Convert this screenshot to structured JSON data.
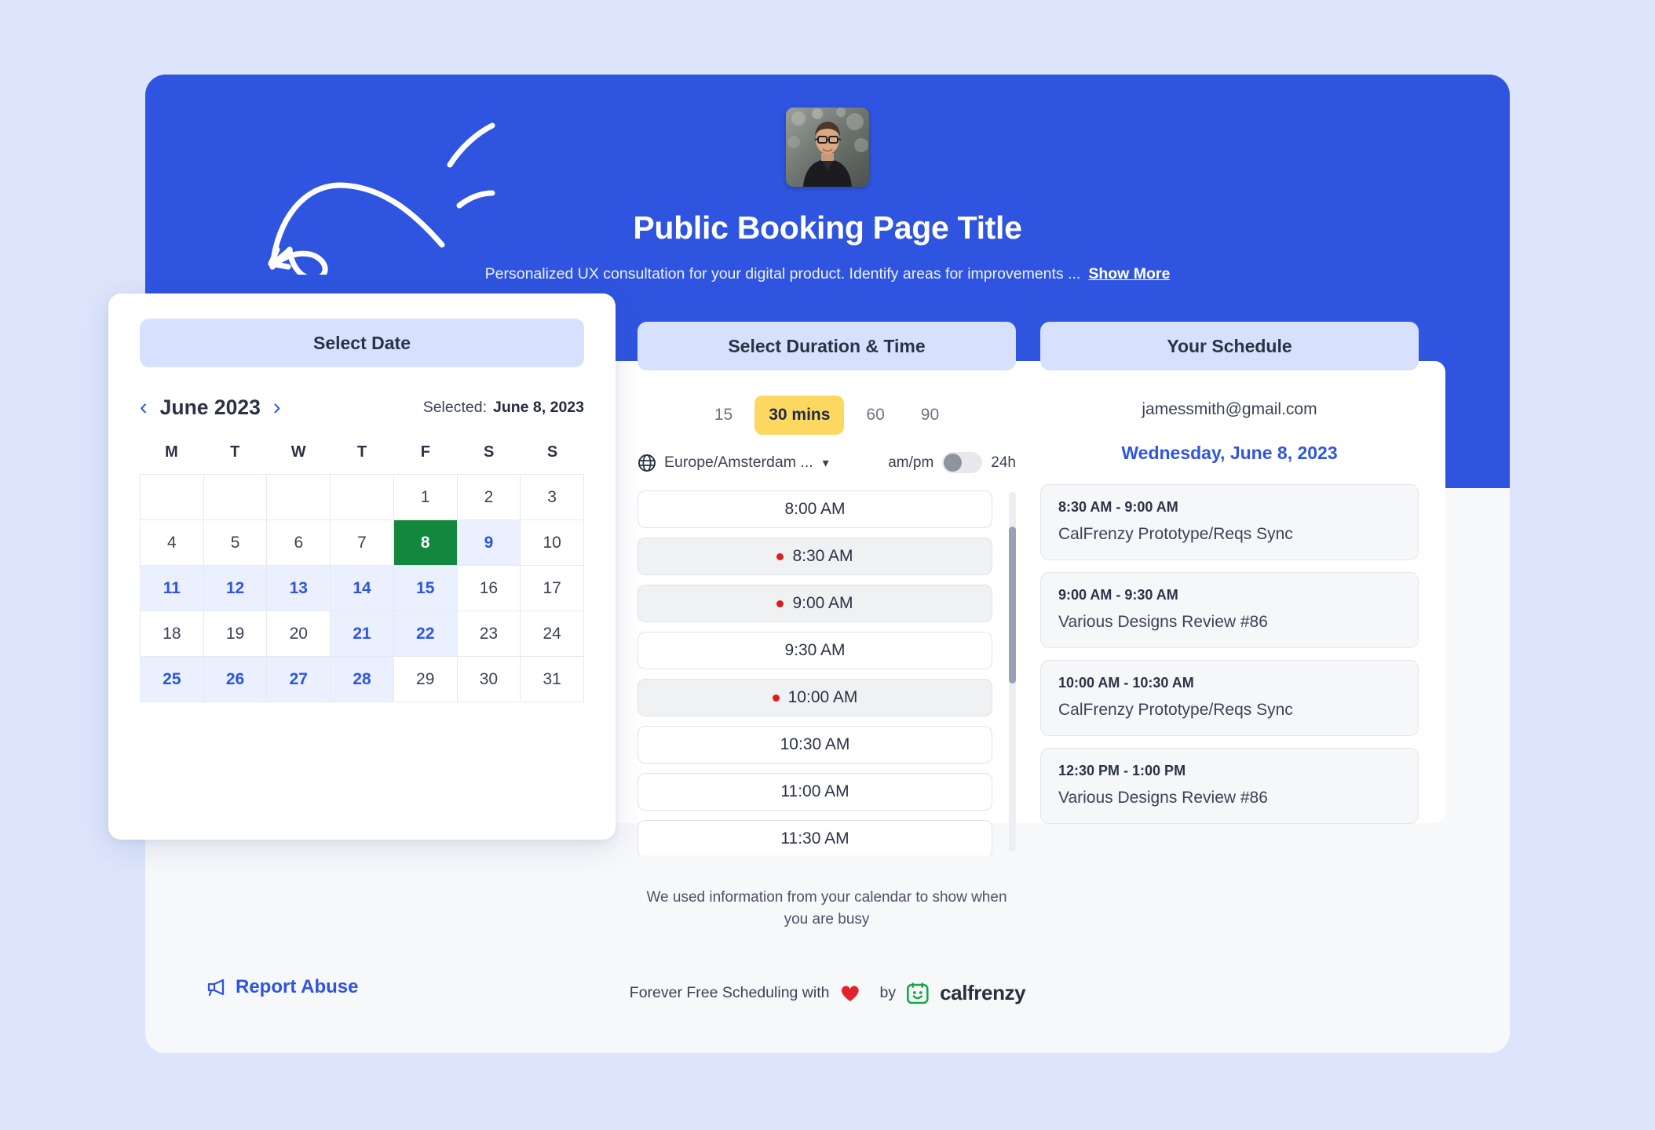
{
  "hero": {
    "avatar_alt": "avatar-photo",
    "title": "Public Booking Page Title",
    "subtitle": "Personalized UX consultation for your digital product. Identify areas for improvements ...",
    "show_more": "Show More",
    "bg_color": "#2f55e0"
  },
  "calendar": {
    "header": "Select Date",
    "prev_icon": "‹",
    "next_icon": "›",
    "month_label": "June 2023",
    "selected_label": "Selected:",
    "selected_value": "June 8, 2023",
    "day_initials": [
      "M",
      "T",
      "W",
      "T",
      "F",
      "S",
      "S"
    ],
    "leading_blanks": 4,
    "days": [
      {
        "n": 1,
        "state": "plain"
      },
      {
        "n": 2,
        "state": "plain"
      },
      {
        "n": 3,
        "state": "plain"
      },
      {
        "n": 4,
        "state": "plain"
      },
      {
        "n": 5,
        "state": "plain"
      },
      {
        "n": 6,
        "state": "plain"
      },
      {
        "n": 7,
        "state": "plain"
      },
      {
        "n": 8,
        "state": "sel"
      },
      {
        "n": 9,
        "state": "avail"
      },
      {
        "n": 10,
        "state": "plain"
      },
      {
        "n": 11,
        "state": "avail"
      },
      {
        "n": 12,
        "state": "avail"
      },
      {
        "n": 13,
        "state": "avail"
      },
      {
        "n": 14,
        "state": "avail"
      },
      {
        "n": 15,
        "state": "avail"
      },
      {
        "n": 16,
        "state": "plain"
      },
      {
        "n": 17,
        "state": "plain"
      },
      {
        "n": 18,
        "state": "plain"
      },
      {
        "n": 19,
        "state": "plain"
      },
      {
        "n": 20,
        "state": "plain"
      },
      {
        "n": 21,
        "state": "avail"
      },
      {
        "n": 22,
        "state": "avail"
      },
      {
        "n": 23,
        "state": "plain"
      },
      {
        "n": 24,
        "state": "plain"
      },
      {
        "n": 25,
        "state": "avail"
      },
      {
        "n": 26,
        "state": "avail"
      },
      {
        "n": 27,
        "state": "avail"
      },
      {
        "n": 28,
        "state": "avail"
      },
      {
        "n": 29,
        "state": "plain"
      },
      {
        "n": 30,
        "state": "plain"
      },
      {
        "n": 31,
        "state": "plain"
      }
    ],
    "selected_color": "#12883e",
    "available_color": "#2f55e0"
  },
  "duration": {
    "header": "Select Duration & Time",
    "options": [
      {
        "label": "15",
        "active": false
      },
      {
        "label": "30 mins",
        "active": true
      },
      {
        "label": "60",
        "active": false
      },
      {
        "label": "90",
        "active": false
      }
    ],
    "active_color": "#fdd861",
    "timezone": "Europe/Amsterdam ...",
    "timezone_caret": "⌄",
    "ampm_label": "am/pm",
    "h24_label": "24h",
    "toggle_state": "am/pm",
    "slots": [
      {
        "time": "8:00 AM",
        "busy": false
      },
      {
        "time": "8:30 AM",
        "busy": true
      },
      {
        "time": "9:00 AM",
        "busy": true
      },
      {
        "time": "9:30 AM",
        "busy": false
      },
      {
        "time": "10:00 AM",
        "busy": true
      },
      {
        "time": "10:30 AM",
        "busy": false
      },
      {
        "time": "11:00 AM",
        "busy": false
      },
      {
        "time": "11:30 AM",
        "busy": false
      }
    ],
    "busy_note": "We used information from your calendar to show when you are busy",
    "busy_dot_color": "#e01b1b"
  },
  "schedule": {
    "header": "Your Schedule",
    "email": "jamessmith@gmail.com",
    "date": "Wednesday, June 8, 2023",
    "date_color": "#2f55e0",
    "events": [
      {
        "time": "8:30 AM - 9:00 AM",
        "title": "CalFrenzy Prototype/Reqs Sync"
      },
      {
        "time": "9:00 AM - 9:30 AM",
        "title": "Various Designs Review #86"
      },
      {
        "time": "10:00 AM - 10:30 AM",
        "title": "CalFrenzy Prototype/Reqs Sync"
      },
      {
        "time": "12:30 PM - 1:00 PM",
        "title": "Various Designs Review #86"
      }
    ]
  },
  "footer": {
    "report_abuse": "Report Abuse",
    "report_color": "#2f55e0",
    "brand_prefix": "Forever Free Scheduling with",
    "heart_icon": "heart-icon",
    "by": "by",
    "brand_name": "calfrenzy",
    "brand_logo_color": "#1aa74a"
  }
}
